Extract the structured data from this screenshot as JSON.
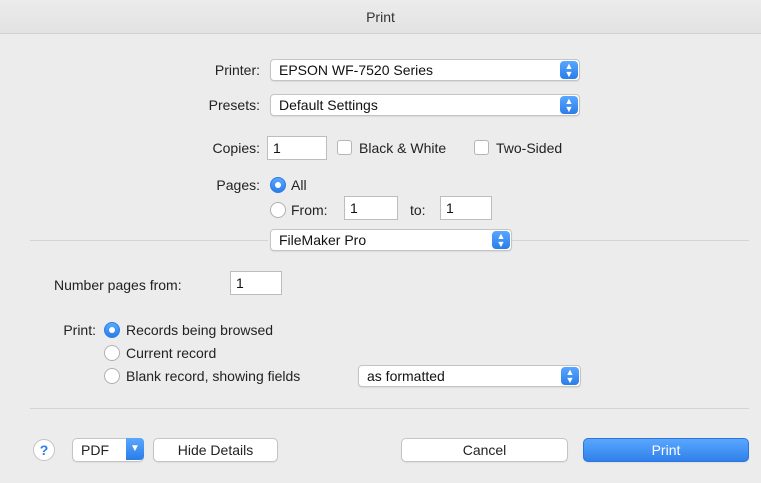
{
  "window": {
    "title": "Print"
  },
  "printer": {
    "label": "Printer:",
    "value": "EPSON WF-7520 Series"
  },
  "presets": {
    "label": "Presets:",
    "value": "Default Settings"
  },
  "copies": {
    "label": "Copies:",
    "value": "1",
    "black_white_label": "Black & White",
    "two_sided_label": "Two-Sided"
  },
  "pages": {
    "label": "Pages:",
    "all_label": "All",
    "from_label": "From:",
    "from_value": "1",
    "to_label": "to:",
    "to_value": "1"
  },
  "section_popup": {
    "value": "FileMaker Pro"
  },
  "number_pages": {
    "label": "Number pages from:",
    "value": "1"
  },
  "print_options": {
    "label": "Print:",
    "records_browsed": "Records being browsed",
    "current_record": "Current record",
    "blank_record": "Blank record, showing fields",
    "blank_format": "as formatted"
  },
  "footer": {
    "help": "?",
    "pdf": "PDF",
    "hide_details": "Hide Details",
    "cancel": "Cancel",
    "print": "Print"
  },
  "colors": {
    "accent": "#2a7de8"
  }
}
